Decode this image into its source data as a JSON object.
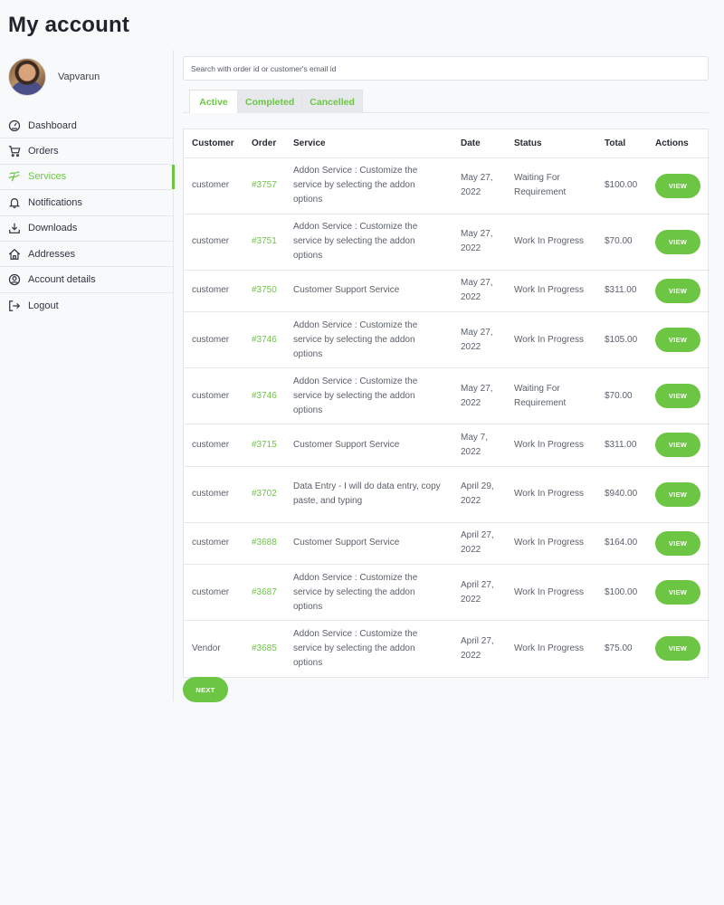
{
  "page": {
    "title": "My account"
  },
  "profile": {
    "username": "Vapvarun"
  },
  "nav": [
    {
      "label": "Dashboard",
      "icon": "dashboard-gauge-icon",
      "name": "sidebar-item-dashboard"
    },
    {
      "label": "Orders",
      "icon": "cart-icon",
      "name": "sidebar-item-orders"
    },
    {
      "label": "Services",
      "icon": "services-icon",
      "name": "sidebar-item-services",
      "active": true
    },
    {
      "label": "Notifications",
      "icon": "bell-icon",
      "name": "sidebar-item-notifications"
    },
    {
      "label": "Downloads",
      "icon": "download-icon",
      "name": "sidebar-item-downloads"
    },
    {
      "label": "Addresses",
      "icon": "home-icon",
      "name": "sidebar-item-addresses"
    },
    {
      "label": "Account details",
      "icon": "user-circle-icon",
      "name": "sidebar-item-account-details"
    },
    {
      "label": "Logout",
      "icon": "logout-icon",
      "name": "sidebar-item-logout"
    }
  ],
  "search": {
    "placeholder": "Search with order id or customer's email id"
  },
  "tabs": [
    {
      "label": "Active",
      "active": true
    },
    {
      "label": "Completed"
    },
    {
      "label": "Cancelled"
    }
  ],
  "table": {
    "headers": [
      "Customer",
      "Order",
      "Service",
      "Date",
      "Status",
      "Total",
      "Actions"
    ],
    "rows": [
      {
        "customer": "customer",
        "order": "#3757",
        "service": "Addon Service : Customize the service by selecting the addon options",
        "date": "May 27, 2022",
        "status": "Waiting For Requirement",
        "total": "$100.00",
        "action": "VIEW"
      },
      {
        "customer": "customer",
        "order": "#3751",
        "service": "Addon Service : Customize the service by selecting the addon options",
        "date": "May 27, 2022",
        "status": "Work In Progress",
        "total": "$70.00",
        "action": "VIEW"
      },
      {
        "customer": "customer",
        "order": "#3750",
        "service": "Customer Support Service",
        "date": "May 27, 2022",
        "status": "Work In Progress",
        "total": "$311.00",
        "action": "VIEW"
      },
      {
        "customer": "customer",
        "order": "#3746",
        "service": "Addon Service : Customize the service by selecting the addon options",
        "date": "May 27, 2022",
        "status": "Work In Progress",
        "total": "$105.00",
        "action": "VIEW"
      },
      {
        "customer": "customer",
        "order": "#3746",
        "service": "Addon Service : Customize the service by selecting the addon options",
        "date": "May 27, 2022",
        "status": "Waiting For Requirement",
        "total": "$70.00",
        "action": "VIEW"
      },
      {
        "customer": "customer",
        "order": "#3715",
        "service": "Customer Support Service",
        "date": "May 7, 2022",
        "status": "Work In Progress",
        "total": "$311.00",
        "action": "VIEW"
      },
      {
        "customer": "customer",
        "order": "#3702",
        "service": "Data Entry - I will do data entry, copy paste, and typing",
        "date": "April 29, 2022",
        "status": "Work In Progress",
        "total": "$940.00",
        "action": "VIEW"
      },
      {
        "customer": "customer",
        "order": "#3688",
        "service": "Customer Support Service",
        "date": "April 27, 2022",
        "status": "Work In Progress",
        "total": "$164.00",
        "action": "VIEW"
      },
      {
        "customer": "customer",
        "order": "#3687",
        "service": "Addon Service : Customize the service by selecting the addon options",
        "date": "April 27, 2022",
        "status": "Work In Progress",
        "total": "$100.00",
        "action": "VIEW"
      },
      {
        "customer": "Vendor",
        "order": "#3685",
        "service": "Addon Service : Customize the service by selecting the addon options",
        "date": "April 27, 2022",
        "status": "Work In Progress",
        "total": "$75.00",
        "action": "VIEW"
      }
    ]
  },
  "pagination": {
    "next_label": "NEXT"
  },
  "colors": {
    "accent": "#6cc644",
    "border": "#e4e6ea",
    "background": "#f8f9fb"
  }
}
